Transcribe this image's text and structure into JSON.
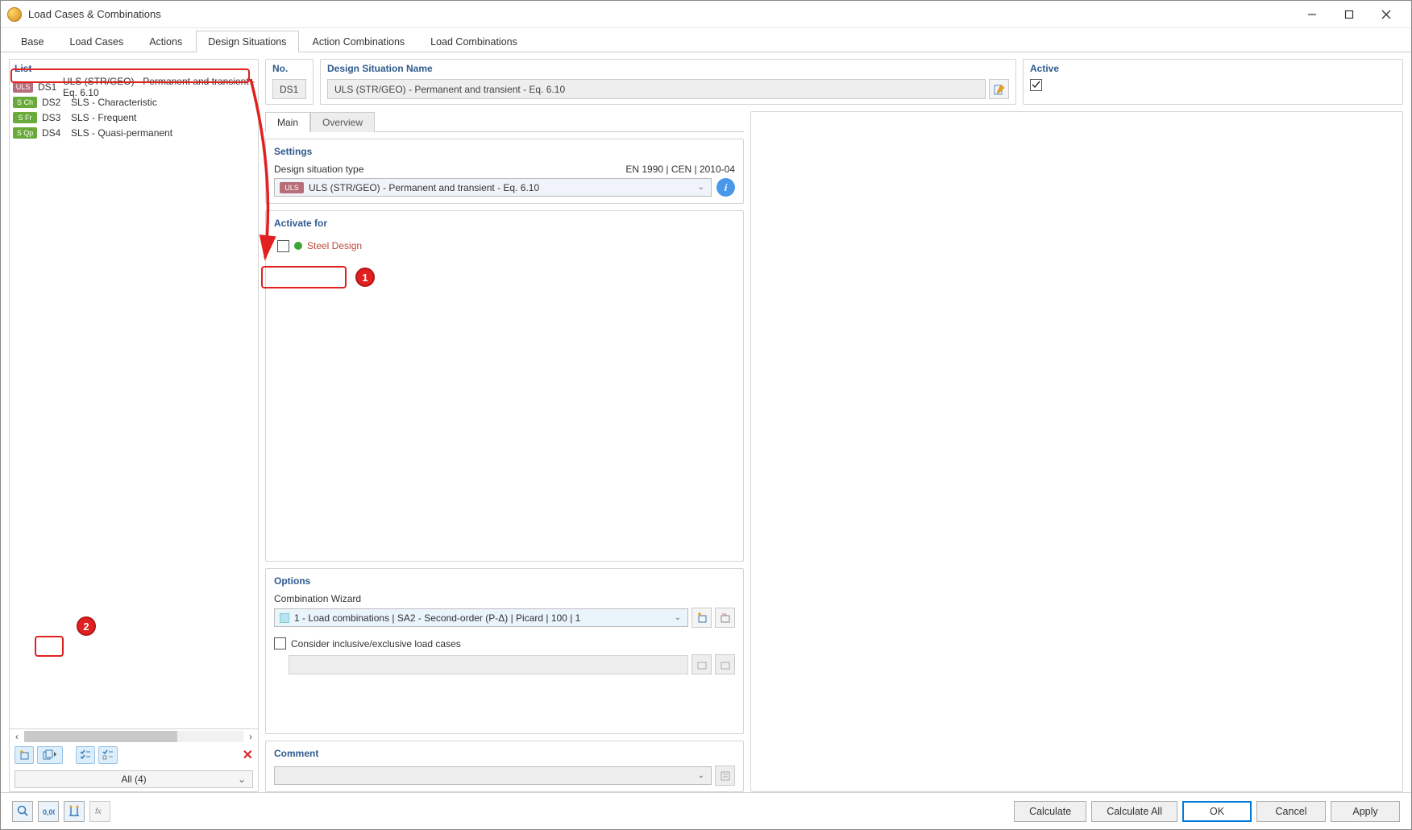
{
  "window": {
    "title": "Load Cases & Combinations"
  },
  "tabs": [
    "Base",
    "Load Cases",
    "Actions",
    "Design Situations",
    "Action Combinations",
    "Load Combinations"
  ],
  "activeTabIndex": 3,
  "list": {
    "header": "List",
    "items": [
      {
        "badge": "ULS",
        "badgeClass": "uls",
        "code": "DS1",
        "label": "ULS (STR/GEO) - Permanent and transient - Eq. 6.10",
        "selected": true
      },
      {
        "badge": "S Ch",
        "badgeClass": "sch",
        "code": "DS2",
        "label": "SLS - Characteristic"
      },
      {
        "badge": "S Fr",
        "badgeClass": "sfr",
        "code": "DS3",
        "label": "SLS - Frequent"
      },
      {
        "badge": "S Qp",
        "badgeClass": "sqp",
        "code": "DS4",
        "label": "SLS - Quasi-permanent"
      }
    ],
    "filter": "All (4)"
  },
  "fields": {
    "noLabel": "No.",
    "noValue": "DS1",
    "nameLabel": "Design Situation Name",
    "nameValue": "ULS (STR/GEO) - Permanent and transient - Eq. 6.10",
    "activeLabel": "Active",
    "activeChecked": true
  },
  "subtabs": [
    "Main",
    "Overview"
  ],
  "activeSubtabIndex": 0,
  "settings": {
    "title": "Settings",
    "typeLabel": "Design situation type",
    "standard": "EN 1990 | CEN | 2010-04",
    "dropdownBadge": "ULS",
    "dropdownText": "ULS (STR/GEO) - Permanent and transient - Eq. 6.10"
  },
  "activate": {
    "title": "Activate for",
    "checkboxLabel": "Steel Design"
  },
  "options": {
    "title": "Options",
    "wizardLabel": "Combination Wizard",
    "wizardValue": "1 - Load combinations | SA2 - Second-order (P-Δ) | Picard | 100 | 1",
    "considerLabel": "Consider inclusive/exclusive load cases"
  },
  "comment": {
    "title": "Comment",
    "value": ""
  },
  "footer": {
    "calculate": "Calculate",
    "calculateAll": "Calculate All",
    "ok": "OK",
    "cancel": "Cancel",
    "apply": "Apply"
  },
  "annotations": {
    "marker1": "1",
    "marker2": "2"
  }
}
